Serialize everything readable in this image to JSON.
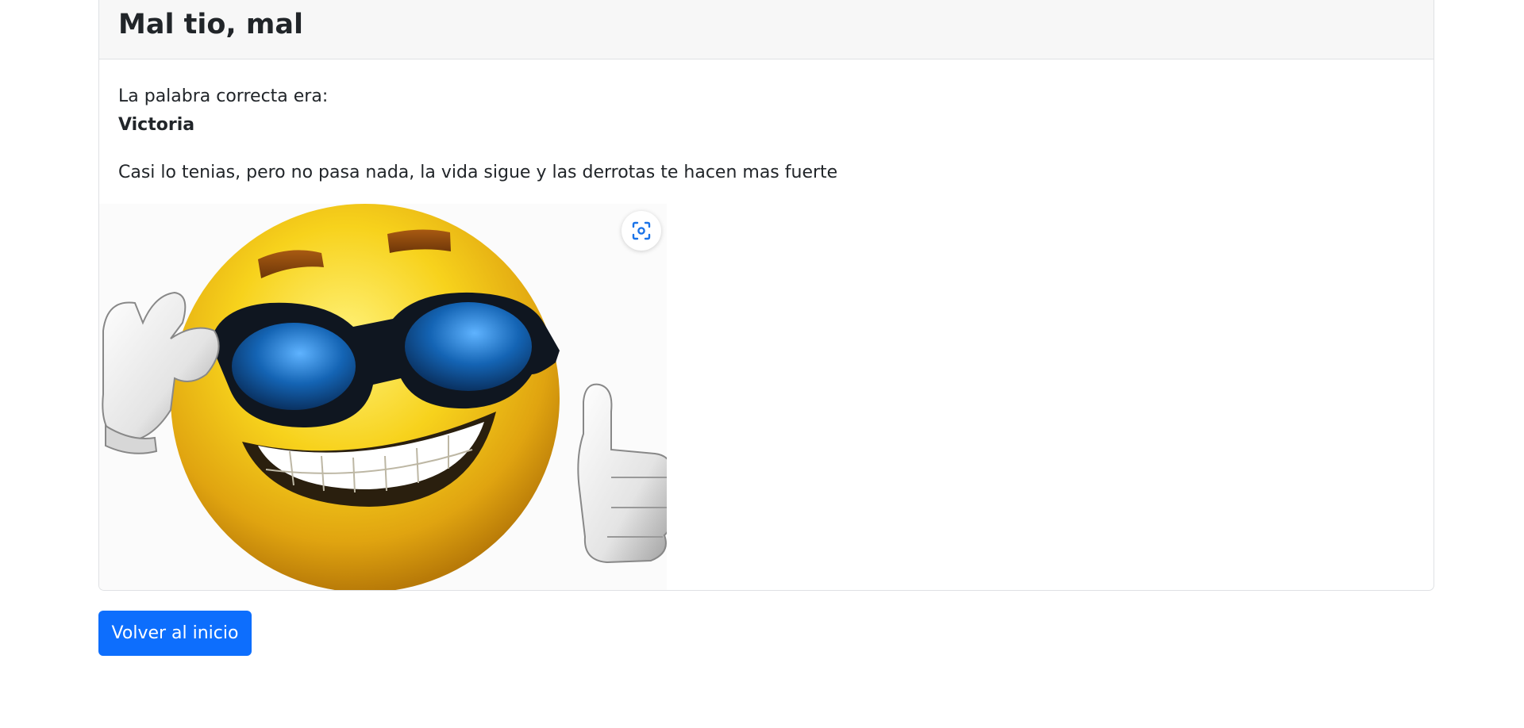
{
  "card": {
    "title": "Mal tio, mal",
    "label": "La palabra correcta era:",
    "answer": "Victoria",
    "message": "Casi lo tenias, pero no pasa nada, la vida sigue y las derrotas te hacen mas fuerte"
  },
  "image": {
    "description_icon": "smiley-sunglasses-thumbs-up",
    "lens_icon": "visual-search-icon"
  },
  "actions": {
    "back_label": "Volver al inicio"
  },
  "colors": {
    "primary": "#0d6efd",
    "header_bg": "#f7f7f7",
    "border": "#dfe1e4",
    "text": "#212529"
  }
}
